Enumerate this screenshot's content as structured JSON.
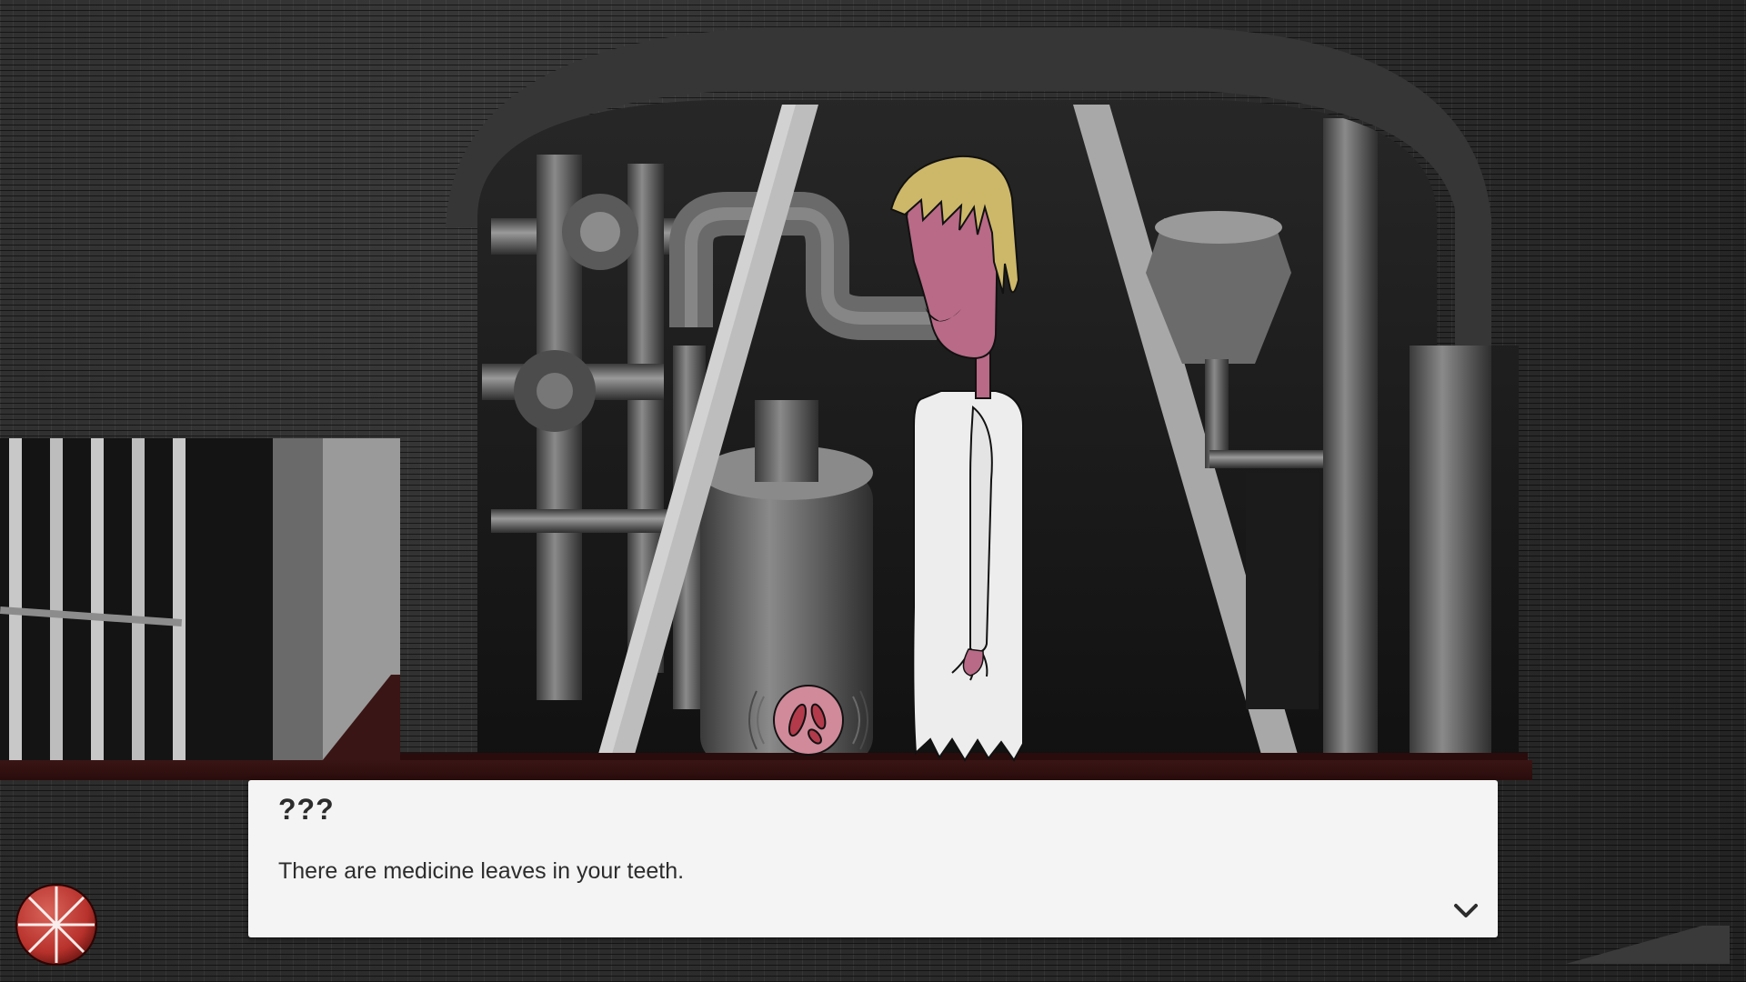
{
  "dialog": {
    "speaker": "???",
    "text": "There are medicine leaves in your teeth."
  },
  "icons": {
    "continue": "chevron-down-icon",
    "menu": "menu-orb-icon",
    "item": "pill-token-icon"
  },
  "colors": {
    "dialog_background": "#f4f4f4",
    "dialog_text": "#2c2c2c",
    "wall": "#2b2b2b",
    "floor": "#3a1515",
    "skin": "#b86a86",
    "hair": "#cdb86a",
    "gown": "#ededed",
    "orb": "#b8322c"
  }
}
